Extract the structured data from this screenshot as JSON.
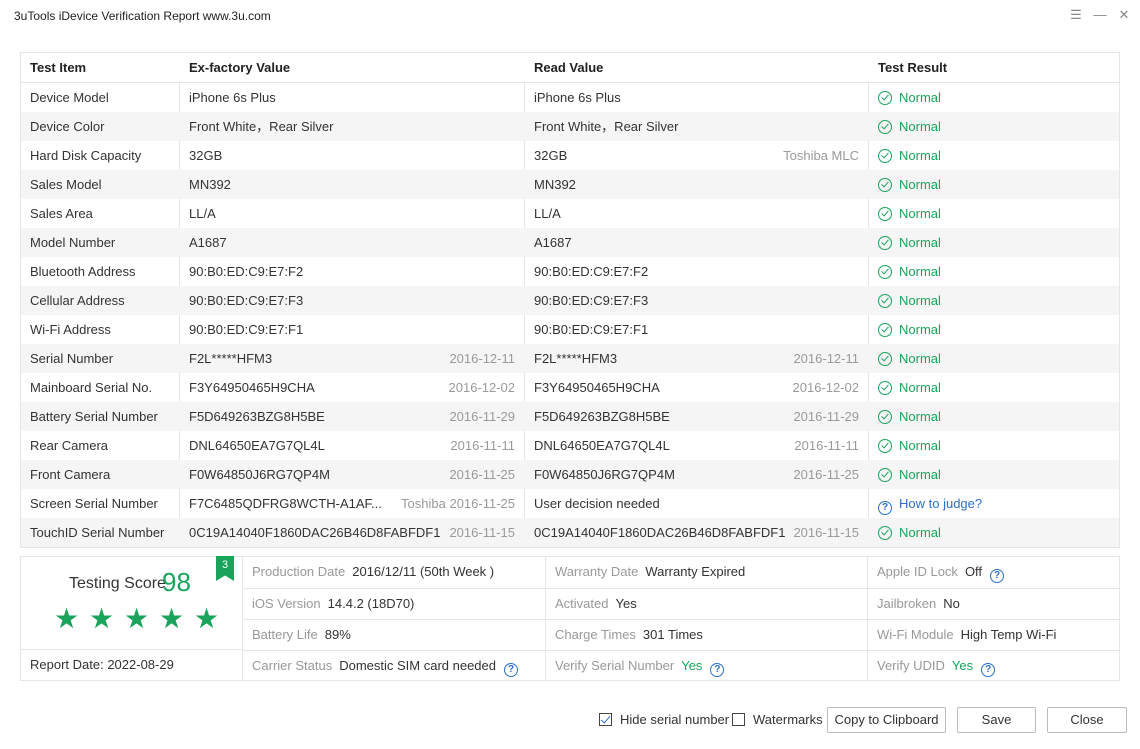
{
  "window": {
    "title": "3uTools iDevice Verification Report www.3u.com",
    "menu_icon": "list-menu-icon",
    "minimize_icon": "minimize-icon",
    "close_icon": "close-icon"
  },
  "table": {
    "headers": [
      "Test Item",
      "Ex-factory Value",
      "Read Value",
      "Test Result"
    ],
    "rows": [
      {
        "item": "Device Model",
        "ex": "iPhone 6s Plus",
        "ex_note": "",
        "read": "iPhone 6s Plus",
        "read_note": "",
        "result": "Normal",
        "status": "normal"
      },
      {
        "item": "Device Color",
        "ex": "Front White，Rear Silver",
        "ex_note": "",
        "read": "Front White，Rear Silver",
        "read_note": "",
        "result": "Normal",
        "status": "normal"
      },
      {
        "item": "Hard Disk Capacity",
        "ex": "32GB",
        "ex_note": "",
        "read": "32GB",
        "read_note": "Toshiba MLC",
        "result": "Normal",
        "status": "normal"
      },
      {
        "item": "Sales Model",
        "ex": "MN392",
        "ex_note": "",
        "read": "MN392",
        "read_note": "",
        "result": "Normal",
        "status": "normal"
      },
      {
        "item": "Sales Area",
        "ex": "LL/A",
        "ex_note": "",
        "read": "LL/A",
        "read_note": "",
        "result": "Normal",
        "status": "normal"
      },
      {
        "item": "Model Number",
        "ex": "A1687",
        "ex_note": "",
        "read": "A1687",
        "read_note": "",
        "result": "Normal",
        "status": "normal"
      },
      {
        "item": "Bluetooth Address",
        "ex": "90:B0:ED:C9:E7:F2",
        "ex_note": "",
        "read": "90:B0:ED:C9:E7:F2",
        "read_note": "",
        "result": "Normal",
        "status": "normal"
      },
      {
        "item": "Cellular Address",
        "ex": "90:B0:ED:C9:E7:F3",
        "ex_note": "",
        "read": "90:B0:ED:C9:E7:F3",
        "read_note": "",
        "result": "Normal",
        "status": "normal"
      },
      {
        "item": "Wi-Fi Address",
        "ex": "90:B0:ED:C9:E7:F1",
        "ex_note": "",
        "read": "90:B0:ED:C9:E7:F1",
        "read_note": "",
        "result": "Normal",
        "status": "normal"
      },
      {
        "item": "Serial Number",
        "ex": "F2L*****HFM3",
        "ex_note": "2016-12-11",
        "read": "F2L*****HFM3",
        "read_note": "2016-12-11",
        "result": "Normal",
        "status": "normal"
      },
      {
        "item": "Mainboard Serial No.",
        "ex": "F3Y64950465H9CHA",
        "ex_note": "2016-12-02",
        "read": "F3Y64950465H9CHA",
        "read_note": "2016-12-02",
        "result": "Normal",
        "status": "normal"
      },
      {
        "item": "Battery Serial Number",
        "ex": "F5D649263BZG8H5BE",
        "ex_note": "2016-11-29",
        "read": "F5D649263BZG8H5BE",
        "read_note": "2016-11-29",
        "result": "Normal",
        "status": "normal"
      },
      {
        "item": "Rear Camera",
        "ex": "DNL64650EA7G7QL4L",
        "ex_note": "2016-11-11",
        "read": "DNL64650EA7G7QL4L",
        "read_note": "2016-11-11",
        "result": "Normal",
        "status": "normal"
      },
      {
        "item": "Front Camera",
        "ex": "F0W64850J6RG7QP4M",
        "ex_note": "2016-11-25",
        "read": "F0W64850J6RG7QP4M",
        "read_note": "2016-11-25",
        "result": "Normal",
        "status": "normal"
      },
      {
        "item": "Screen Serial Number",
        "ex": "F7C6485QDFRG8WCTH-A1AF...",
        "ex_note": "Toshiba 2016-11-25",
        "read": "User decision needed",
        "read_note": "",
        "result": "How to judge?",
        "status": "link"
      },
      {
        "item": "TouchID Serial Number",
        "ex": "0C19A14040F1860DAC26B46D8FABFDF1",
        "ex_note": "2016-11-15",
        "read": "0C19A14040F1860DAC26B46D8FABFDF1",
        "read_note": "2016-11-15",
        "result": "Normal",
        "status": "normal"
      }
    ]
  },
  "summary": {
    "score_label": "Testing Score",
    "score": "98",
    "badge": "3",
    "stars": 5,
    "report_date_label": "Report Date:",
    "report_date": "2022-08-29",
    "fields": [
      [
        {
          "label": "Production Date",
          "value": "2016/12/11 (50th Week )",
          "green": false,
          "help": false
        },
        {
          "label": "Warranty Date",
          "value": "Warranty Expired",
          "green": false,
          "help": false
        },
        {
          "label": "Apple ID Lock",
          "value": "Off",
          "green": false,
          "help": true
        }
      ],
      [
        {
          "label": "iOS Version",
          "value": "14.4.2 (18D70)",
          "green": false,
          "help": false
        },
        {
          "label": "Activated",
          "value": "Yes",
          "green": false,
          "help": false
        },
        {
          "label": "Jailbroken",
          "value": "No",
          "green": false,
          "help": false
        }
      ],
      [
        {
          "label": "Battery Life",
          "value": "89%",
          "green": false,
          "help": false
        },
        {
          "label": "Charge Times",
          "value": "301 Times",
          "green": false,
          "help": false
        },
        {
          "label": "Wi-Fi Module",
          "value": "High Temp Wi-Fi",
          "green": false,
          "help": false
        }
      ],
      [
        {
          "label": "Carrier Status",
          "value": "Domestic SIM card needed",
          "green": false,
          "help": true
        },
        {
          "label": "Verify Serial Number",
          "value": "Yes",
          "green": true,
          "help": true
        },
        {
          "label": "Verify UDID",
          "value": "Yes",
          "green": true,
          "help": true
        }
      ]
    ]
  },
  "footer": {
    "hide_serial_label": "Hide serial number",
    "hide_serial_checked": true,
    "watermarks_label": "Watermarks",
    "watermarks_checked": false,
    "copy_label": "Copy to Clipboard",
    "save_label": "Save",
    "close_label": "Close"
  },
  "colors": {
    "accent_green": "#1aa35a",
    "link_blue": "#2b70c9"
  }
}
